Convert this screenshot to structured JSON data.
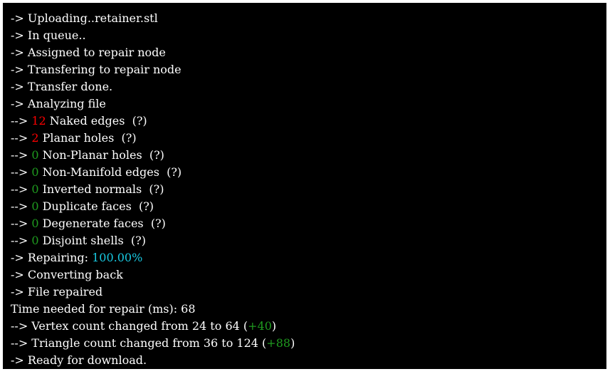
{
  "colors": {
    "background": "#000000",
    "text": "#ffffff",
    "error_count": "#ff0000",
    "ok_count": "#1f9a1f",
    "progress": "#18c8e0"
  },
  "log": {
    "uploading": "-> Uploading..retainer.stl",
    "in_queue": "-> In queue..",
    "assigned": "-> Assigned to repair node",
    "transfering": "-> Transfering to repair node",
    "transfer_done": "-> Transfer done.",
    "analyzing": "-> Analyzing file",
    "naked_edges": {
      "prefix": "--> ",
      "count": "12",
      "label": " Naked edges  (?)"
    },
    "planar_holes": {
      "prefix": "--> ",
      "count": "2",
      "label": " Planar holes  (?)"
    },
    "nonplanar_holes": {
      "prefix": "--> ",
      "count": "0",
      "label": " Non-Planar holes  (?)"
    },
    "nonmanifold_edges": {
      "prefix": "--> ",
      "count": "0",
      "label": " Non-Manifold edges  (?)"
    },
    "inverted_normals": {
      "prefix": "--> ",
      "count": "0",
      "label": " Inverted normals  (?)"
    },
    "duplicate_faces": {
      "prefix": "--> ",
      "count": "0",
      "label": " Duplicate faces  (?)"
    },
    "degenerate_faces": {
      "prefix": "--> ",
      "count": "0",
      "label": " Degenerate faces  (?)"
    },
    "disjoint_shells": {
      "prefix": "--> ",
      "count": "0",
      "label": " Disjoint shells  (?)"
    },
    "repairing": {
      "prefix": "-> Repairing: ",
      "value": "100.00%"
    },
    "converting_back": "-> Converting back",
    "file_repaired": "-> File repaired",
    "time_needed": "Time needed for repair (ms): 68",
    "vertex_count": {
      "text": "--> Vertex count changed from 24 to 64 (",
      "delta": "+40",
      "close": ")"
    },
    "triangle_count": {
      "text": "--> Triangle count changed from 36 to 124 (",
      "delta": "+88",
      "close": ")"
    },
    "ready": "-> Ready for download."
  }
}
